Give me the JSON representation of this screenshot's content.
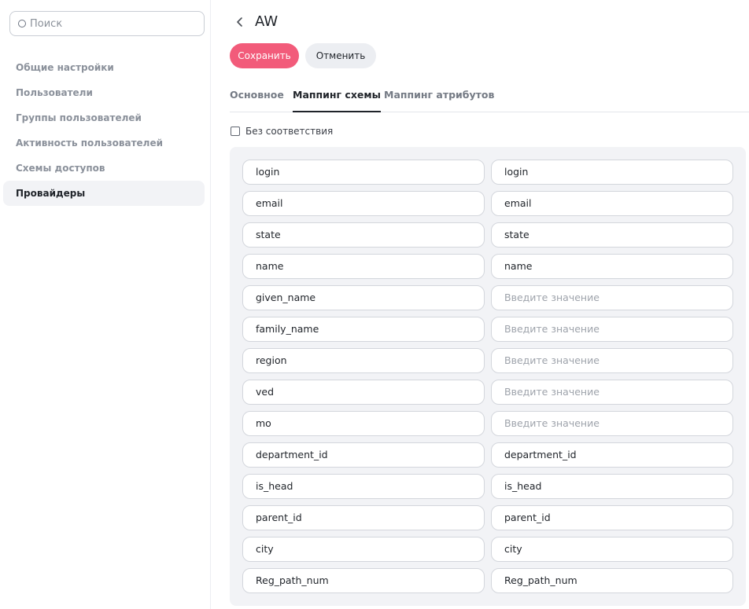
{
  "search": {
    "placeholder": "Поиск"
  },
  "sidebar": {
    "items": [
      {
        "label": "Общие настройки",
        "active": false
      },
      {
        "label": "Пользователи",
        "active": false
      },
      {
        "label": "Группы пользователей",
        "active": false
      },
      {
        "label": "Активность пользователей",
        "active": false
      },
      {
        "label": "Схемы доступов",
        "active": false
      },
      {
        "label": "Провайдеры",
        "active": true
      }
    ]
  },
  "header": {
    "title": "AW"
  },
  "actions": {
    "save_label": "Сохранить",
    "cancel_label": "Отменить"
  },
  "colors": {
    "accent": "#f25b7a",
    "panel": "#f2f3f6"
  },
  "tabs": [
    {
      "label": "Основное",
      "active": false
    },
    {
      "label": "Маппинг схемы",
      "active": true
    },
    {
      "label": "Маппинг атрибутов",
      "active": false
    }
  ],
  "no_mapping": {
    "label": "Без соответствия",
    "checked": false
  },
  "mapping": {
    "placeholder": "Введите значение",
    "rows": [
      {
        "source": "login",
        "target": "login"
      },
      {
        "source": "email",
        "target": "email"
      },
      {
        "source": "state",
        "target": "state"
      },
      {
        "source": "name",
        "target": "name"
      },
      {
        "source": "given_name",
        "target": ""
      },
      {
        "source": "family_name",
        "target": ""
      },
      {
        "source": "region",
        "target": ""
      },
      {
        "source": "ved",
        "target": ""
      },
      {
        "source": "mo",
        "target": ""
      },
      {
        "source": "department_id",
        "target": "department_id"
      },
      {
        "source": "is_head",
        "target": "is_head"
      },
      {
        "source": "parent_id",
        "target": "parent_id"
      },
      {
        "source": "city",
        "target": "city"
      },
      {
        "source": "Reg_path_num",
        "target": "Reg_path_num"
      }
    ]
  }
}
